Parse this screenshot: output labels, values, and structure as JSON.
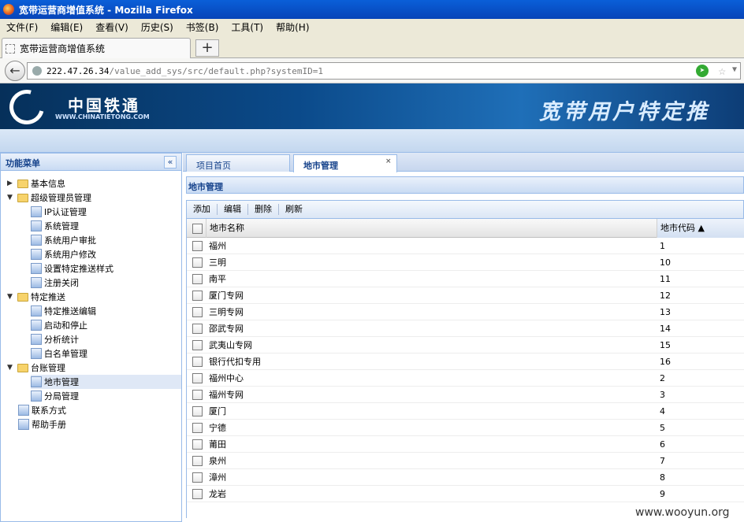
{
  "window": {
    "title": "宽带运营商增值系统 - Mozilla Firefox"
  },
  "menu": [
    "文件(F)",
    "编辑(E)",
    "查看(V)",
    "历史(S)",
    "书签(B)",
    "工具(T)",
    "帮助(H)"
  ],
  "browser_tab": {
    "title": "宽带运营商增值系统",
    "new_tab": "+"
  },
  "address": {
    "host": "222.47.26.34",
    "path": "/value_add_sys/src/default.php?systemID=1"
  },
  "banner": {
    "logo_cn": "中国铁通",
    "logo_en": "WWW.CHINATIETONG.COM",
    "slogan": "宽带用户特定推"
  },
  "sidebar": {
    "title": "功能菜单",
    "collapse": "«",
    "groups": [
      {
        "label": "基本信息",
        "expanded": false,
        "items": []
      },
      {
        "label": "超级管理员管理",
        "expanded": true,
        "items": [
          "IP认证管理",
          "系统管理",
          "系统用户审批",
          "系统用户修改",
          "设置特定推送样式",
          "注册关闭"
        ]
      },
      {
        "label": "特定推送",
        "expanded": true,
        "items": [
          "特定推送编辑",
          "启动和停止",
          "分析统计",
          "白名单管理"
        ]
      },
      {
        "label": "台账管理",
        "expanded": true,
        "items": [
          "地市管理",
          "分局管理"
        ]
      }
    ],
    "bottom": [
      "联系方式",
      "帮助手册"
    ],
    "selected": "地市管理"
  },
  "main": {
    "tabs": [
      {
        "label": "项目首页"
      },
      {
        "label": "地市管理",
        "close": "×"
      }
    ],
    "panel_title": "地市管理",
    "toolbar": [
      "添加",
      "编辑",
      "删除",
      "刷新"
    ],
    "columns": {
      "name": "地市名称",
      "code": "地市代码 ▲"
    },
    "rows": [
      {
        "name": "福州",
        "code": "1"
      },
      {
        "name": "三明",
        "code": "10"
      },
      {
        "name": "南平",
        "code": "11"
      },
      {
        "name": "厦门专网",
        "code": "12"
      },
      {
        "name": "三明专网",
        "code": "13"
      },
      {
        "name": "邵武专网",
        "code": "14"
      },
      {
        "name": "武夷山专网",
        "code": "15"
      },
      {
        "name": "银行代扣专用",
        "code": "16"
      },
      {
        "name": "福州中心",
        "code": "2"
      },
      {
        "name": "福州专网",
        "code": "3"
      },
      {
        "name": "厦门",
        "code": "4"
      },
      {
        "name": "宁德",
        "code": "5"
      },
      {
        "name": "莆田",
        "code": "6"
      },
      {
        "name": "泉州",
        "code": "7"
      },
      {
        "name": "漳州",
        "code": "8"
      },
      {
        "name": "龙岩",
        "code": "9"
      }
    ]
  },
  "watermark": "www.wooyun.org",
  "colors": {
    "titlebar": "#0744b8",
    "panel_border": "#99bbe8",
    "panel_text": "#15428b",
    "banner": "#0b4a8a",
    "selected_row": "#dfe8f6"
  }
}
